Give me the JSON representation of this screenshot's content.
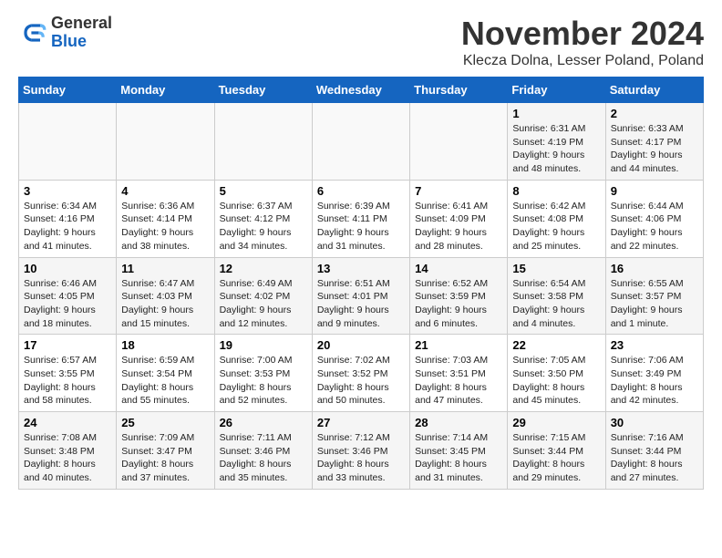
{
  "logo": {
    "general": "General",
    "blue": "Blue"
  },
  "title": "November 2024",
  "location": "Klecza Dolna, Lesser Poland, Poland",
  "days_of_week": [
    "Sunday",
    "Monday",
    "Tuesday",
    "Wednesday",
    "Thursday",
    "Friday",
    "Saturday"
  ],
  "weeks": [
    [
      {
        "day": "",
        "info": ""
      },
      {
        "day": "",
        "info": ""
      },
      {
        "day": "",
        "info": ""
      },
      {
        "day": "",
        "info": ""
      },
      {
        "day": "",
        "info": ""
      },
      {
        "day": "1",
        "info": "Sunrise: 6:31 AM\nSunset: 4:19 PM\nDaylight: 9 hours and 48 minutes."
      },
      {
        "day": "2",
        "info": "Sunrise: 6:33 AM\nSunset: 4:17 PM\nDaylight: 9 hours and 44 minutes."
      }
    ],
    [
      {
        "day": "3",
        "info": "Sunrise: 6:34 AM\nSunset: 4:16 PM\nDaylight: 9 hours and 41 minutes."
      },
      {
        "day": "4",
        "info": "Sunrise: 6:36 AM\nSunset: 4:14 PM\nDaylight: 9 hours and 38 minutes."
      },
      {
        "day": "5",
        "info": "Sunrise: 6:37 AM\nSunset: 4:12 PM\nDaylight: 9 hours and 34 minutes."
      },
      {
        "day": "6",
        "info": "Sunrise: 6:39 AM\nSunset: 4:11 PM\nDaylight: 9 hours and 31 minutes."
      },
      {
        "day": "7",
        "info": "Sunrise: 6:41 AM\nSunset: 4:09 PM\nDaylight: 9 hours and 28 minutes."
      },
      {
        "day": "8",
        "info": "Sunrise: 6:42 AM\nSunset: 4:08 PM\nDaylight: 9 hours and 25 minutes."
      },
      {
        "day": "9",
        "info": "Sunrise: 6:44 AM\nSunset: 4:06 PM\nDaylight: 9 hours and 22 minutes."
      }
    ],
    [
      {
        "day": "10",
        "info": "Sunrise: 6:46 AM\nSunset: 4:05 PM\nDaylight: 9 hours and 18 minutes."
      },
      {
        "day": "11",
        "info": "Sunrise: 6:47 AM\nSunset: 4:03 PM\nDaylight: 9 hours and 15 minutes."
      },
      {
        "day": "12",
        "info": "Sunrise: 6:49 AM\nSunset: 4:02 PM\nDaylight: 9 hours and 12 minutes."
      },
      {
        "day": "13",
        "info": "Sunrise: 6:51 AM\nSunset: 4:01 PM\nDaylight: 9 hours and 9 minutes."
      },
      {
        "day": "14",
        "info": "Sunrise: 6:52 AM\nSunset: 3:59 PM\nDaylight: 9 hours and 6 minutes."
      },
      {
        "day": "15",
        "info": "Sunrise: 6:54 AM\nSunset: 3:58 PM\nDaylight: 9 hours and 4 minutes."
      },
      {
        "day": "16",
        "info": "Sunrise: 6:55 AM\nSunset: 3:57 PM\nDaylight: 9 hours and 1 minute."
      }
    ],
    [
      {
        "day": "17",
        "info": "Sunrise: 6:57 AM\nSunset: 3:55 PM\nDaylight: 8 hours and 58 minutes."
      },
      {
        "day": "18",
        "info": "Sunrise: 6:59 AM\nSunset: 3:54 PM\nDaylight: 8 hours and 55 minutes."
      },
      {
        "day": "19",
        "info": "Sunrise: 7:00 AM\nSunset: 3:53 PM\nDaylight: 8 hours and 52 minutes."
      },
      {
        "day": "20",
        "info": "Sunrise: 7:02 AM\nSunset: 3:52 PM\nDaylight: 8 hours and 50 minutes."
      },
      {
        "day": "21",
        "info": "Sunrise: 7:03 AM\nSunset: 3:51 PM\nDaylight: 8 hours and 47 minutes."
      },
      {
        "day": "22",
        "info": "Sunrise: 7:05 AM\nSunset: 3:50 PM\nDaylight: 8 hours and 45 minutes."
      },
      {
        "day": "23",
        "info": "Sunrise: 7:06 AM\nSunset: 3:49 PM\nDaylight: 8 hours and 42 minutes."
      }
    ],
    [
      {
        "day": "24",
        "info": "Sunrise: 7:08 AM\nSunset: 3:48 PM\nDaylight: 8 hours and 40 minutes."
      },
      {
        "day": "25",
        "info": "Sunrise: 7:09 AM\nSunset: 3:47 PM\nDaylight: 8 hours and 37 minutes."
      },
      {
        "day": "26",
        "info": "Sunrise: 7:11 AM\nSunset: 3:46 PM\nDaylight: 8 hours and 35 minutes."
      },
      {
        "day": "27",
        "info": "Sunrise: 7:12 AM\nSunset: 3:46 PM\nDaylight: 8 hours and 33 minutes."
      },
      {
        "day": "28",
        "info": "Sunrise: 7:14 AM\nSunset: 3:45 PM\nDaylight: 8 hours and 31 minutes."
      },
      {
        "day": "29",
        "info": "Sunrise: 7:15 AM\nSunset: 3:44 PM\nDaylight: 8 hours and 29 minutes."
      },
      {
        "day": "30",
        "info": "Sunrise: 7:16 AM\nSunset: 3:44 PM\nDaylight: 8 hours and 27 minutes."
      }
    ]
  ]
}
